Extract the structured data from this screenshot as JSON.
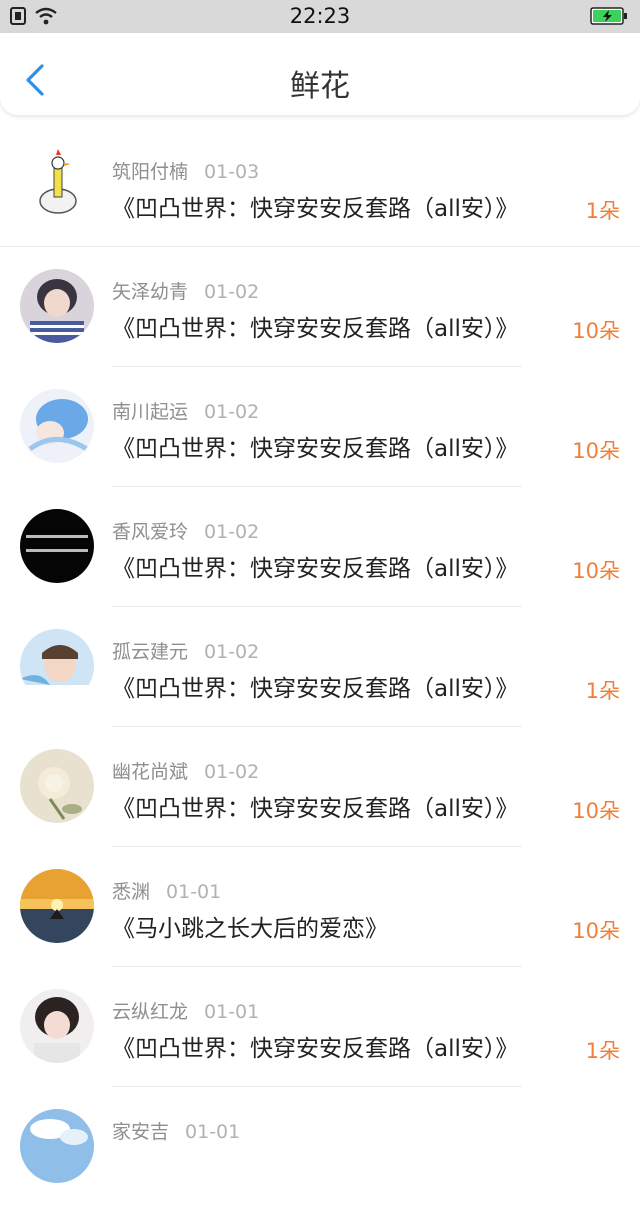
{
  "status_bar": {
    "time": "22:23"
  },
  "navbar": {
    "title": "鲜花"
  },
  "rows": [
    {
      "name": "筑阳付楠",
      "date": "01-03",
      "book": "《凹凸世界：快穿安安反套路（all安）》",
      "amount": "1朵"
    },
    {
      "name": "矢泽幼青",
      "date": "01-02",
      "book": "《凹凸世界：快穿安安反套路（all安）》",
      "amount": "10朵"
    },
    {
      "name": "南川起运",
      "date": "01-02",
      "book": "《凹凸世界：快穿安安反套路（all安）》",
      "amount": "10朵"
    },
    {
      "name": "香风爱玲",
      "date": "01-02",
      "book": "《凹凸世界：快穿安安反套路（all安）》",
      "amount": "10朵"
    },
    {
      "name": "孤云建元",
      "date": "01-02",
      "book": "《凹凸世界：快穿安安反套路（all安）》",
      "amount": "1朵"
    },
    {
      "name": "幽花尚斌",
      "date": "01-02",
      "book": "《凹凸世界：快穿安安反套路（all安）》",
      "amount": "10朵"
    },
    {
      "name": "悉渊",
      "date": "01-01",
      "book": "《马小跳之长大后的爱恋》",
      "amount": "10朵"
    },
    {
      "name": "云纵红龙",
      "date": "01-01",
      "book": "《凹凸世界：快穿安安反套路（all安）》",
      "amount": "1朵"
    },
    {
      "name": "家安吉",
      "date": "01-01",
      "book": "",
      "amount": ""
    }
  ],
  "colors": {
    "accent": "#2e8fe6",
    "amount": "#ef7f3a",
    "status_bar": "#d9d9d9"
  }
}
